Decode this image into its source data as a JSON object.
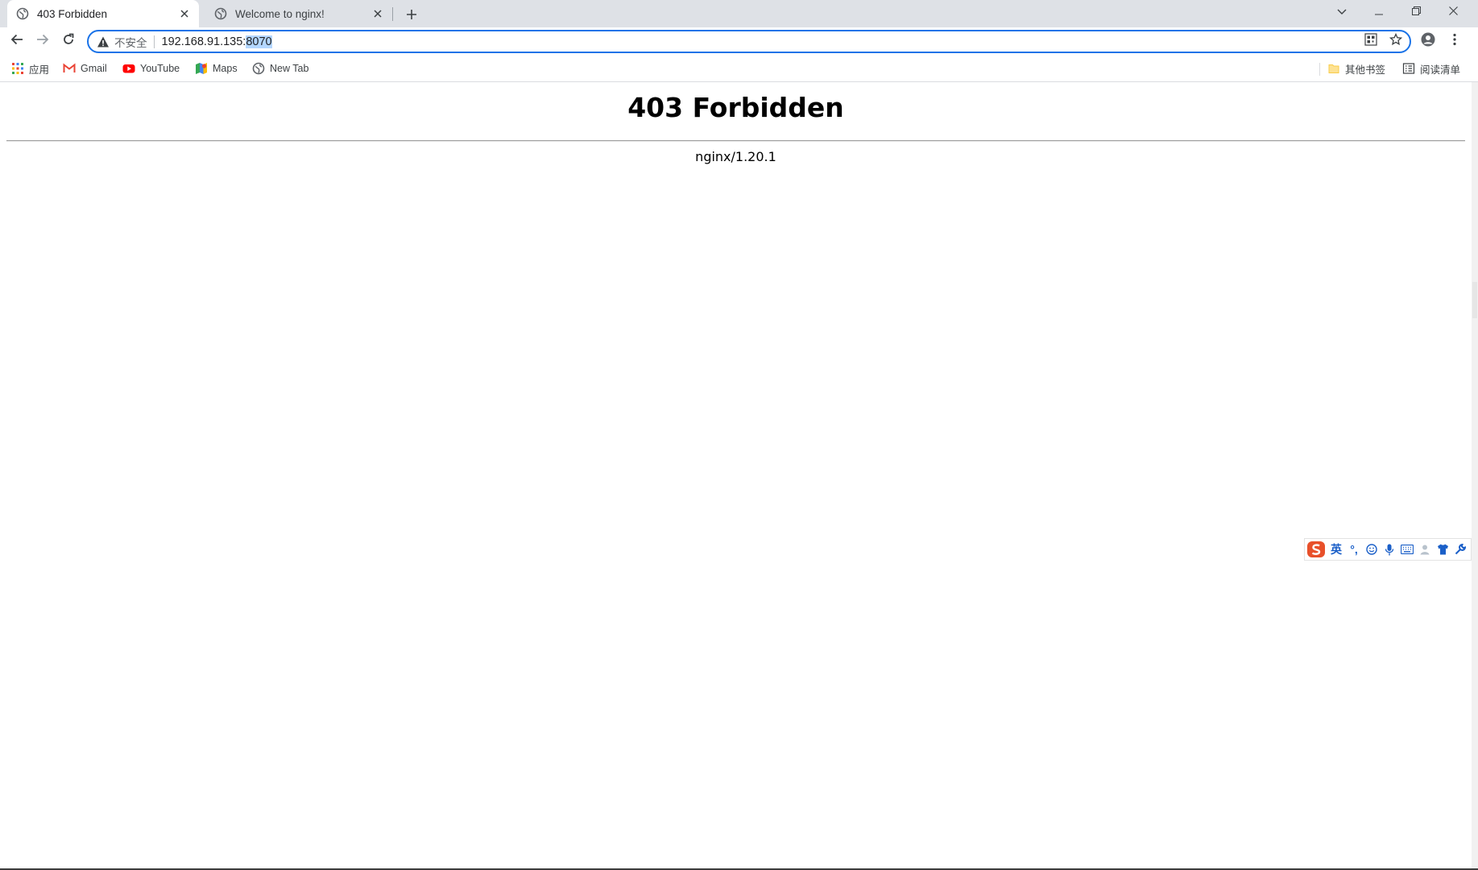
{
  "tabs": [
    {
      "title": "403 Forbidden",
      "active": true,
      "favicon": "globe-icon"
    },
    {
      "title": "Welcome to nginx!",
      "active": false,
      "favicon": "globe-icon"
    }
  ],
  "omnibox": {
    "security_label": "不安全",
    "url_host": "192.168.91.135:",
    "url_selected": "8070"
  },
  "bookmarks": {
    "apps": "应用",
    "gmail": "Gmail",
    "youtube": "YouTube",
    "maps": "Maps",
    "newtab": "New Tab",
    "other": "其他书签",
    "reading_list": "阅读清单"
  },
  "page": {
    "heading": "403 Forbidden",
    "server": "nginx/1.20.1"
  },
  "ime": {
    "lang": "英",
    "punct": "°,"
  },
  "colors": {
    "accent": "#1a73e8",
    "tabstrip": "#dee1e6",
    "ime_logo": "#e8502a"
  }
}
